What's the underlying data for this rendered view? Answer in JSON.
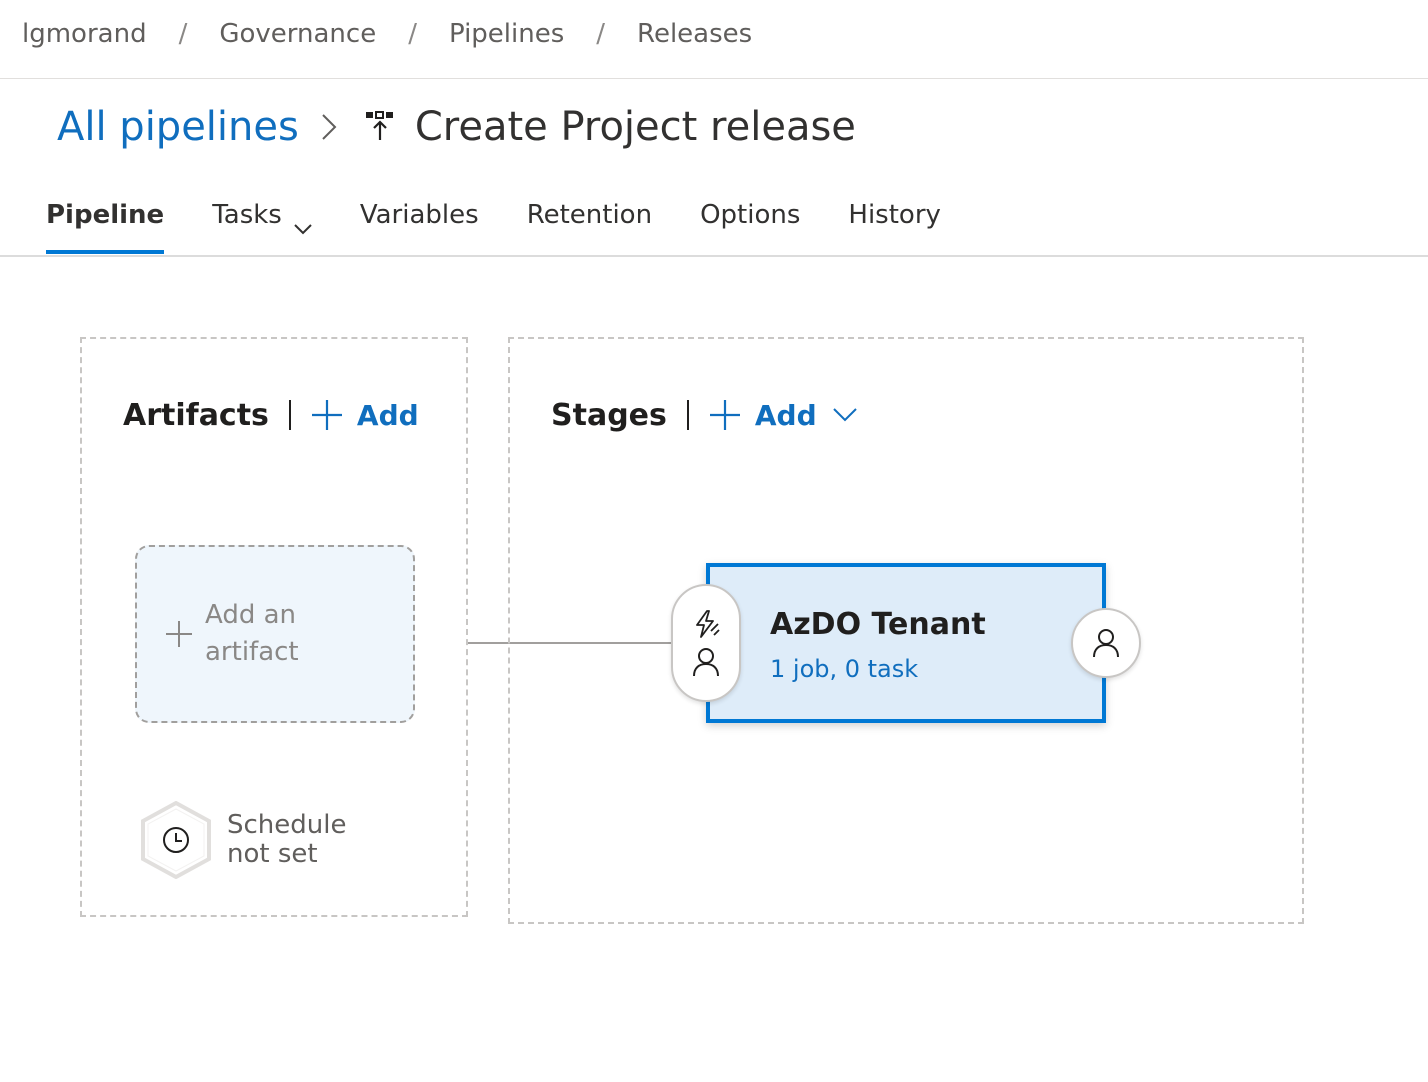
{
  "breadcrumb": {
    "items": [
      "lgmorand",
      "Governance",
      "Pipelines",
      "Releases"
    ],
    "separator": "/"
  },
  "title_row": {
    "all_pipelines_label": "All pipelines",
    "page_title": "Create Project release"
  },
  "tabs": [
    {
      "label": "Pipeline",
      "active": true
    },
    {
      "label": "Tasks",
      "active": false,
      "has_dropdown": true
    },
    {
      "label": "Variables",
      "active": false
    },
    {
      "label": "Retention",
      "active": false
    },
    {
      "label": "Options",
      "active": false
    },
    {
      "label": "History",
      "active": false
    }
  ],
  "artifacts": {
    "title": "Artifacts",
    "add_label": "Add",
    "add_artifact_label": "Add an artifact",
    "schedule_label": "Schedule not set"
  },
  "stages": {
    "title": "Stages",
    "add_label": "Add",
    "stage": {
      "name": "AzDO Tenant",
      "summary": "1 job, 0 task"
    }
  },
  "colors": {
    "accent": "#0078d4",
    "link": "#106ebe",
    "stage_bg": "#deecf9",
    "artifact_bg": "#eff6fc"
  },
  "icons": {
    "release": "release-pipeline-icon",
    "add": "plus-icon",
    "dropdown": "chevron-down-icon",
    "trigger": "lightning-icon",
    "approver": "person-icon",
    "schedule": "clock-icon"
  }
}
